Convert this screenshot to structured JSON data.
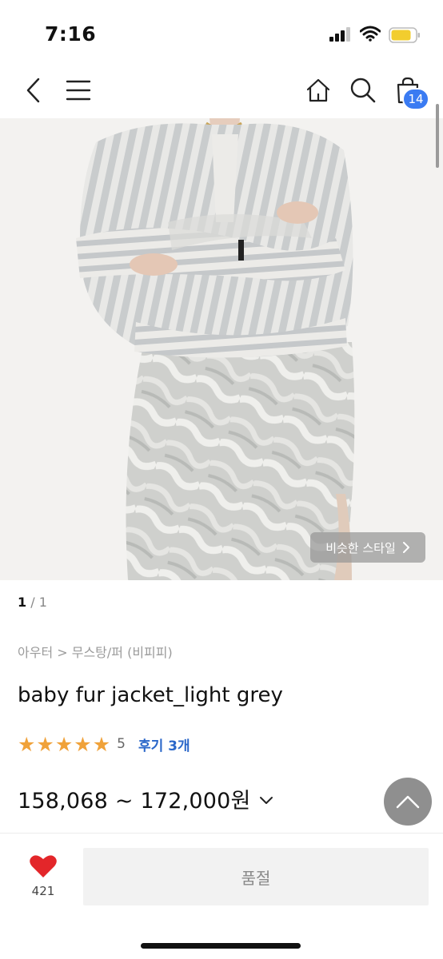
{
  "status": {
    "time": "7:16"
  },
  "header": {
    "cart_count": "14"
  },
  "image": {
    "similar_style_label": "비슷한 스타일"
  },
  "pager": {
    "current": "1",
    "total": "/ 1"
  },
  "product": {
    "breadcrumb": "아우터 > 무스탕/퍼 (비피피)",
    "title": "baby fur jacket_light grey",
    "rating_value": "5",
    "rating_fraction": 1.0,
    "review_label": "후기 3개",
    "price": "158,068 ~ 172,000원"
  },
  "bottom": {
    "like_count": "421",
    "soldout_label": "품절"
  },
  "colors": {
    "accent": "#3a7bf2",
    "star": "#f0a23a",
    "heart": "#e3262a",
    "review_link": "#2a67c9"
  }
}
